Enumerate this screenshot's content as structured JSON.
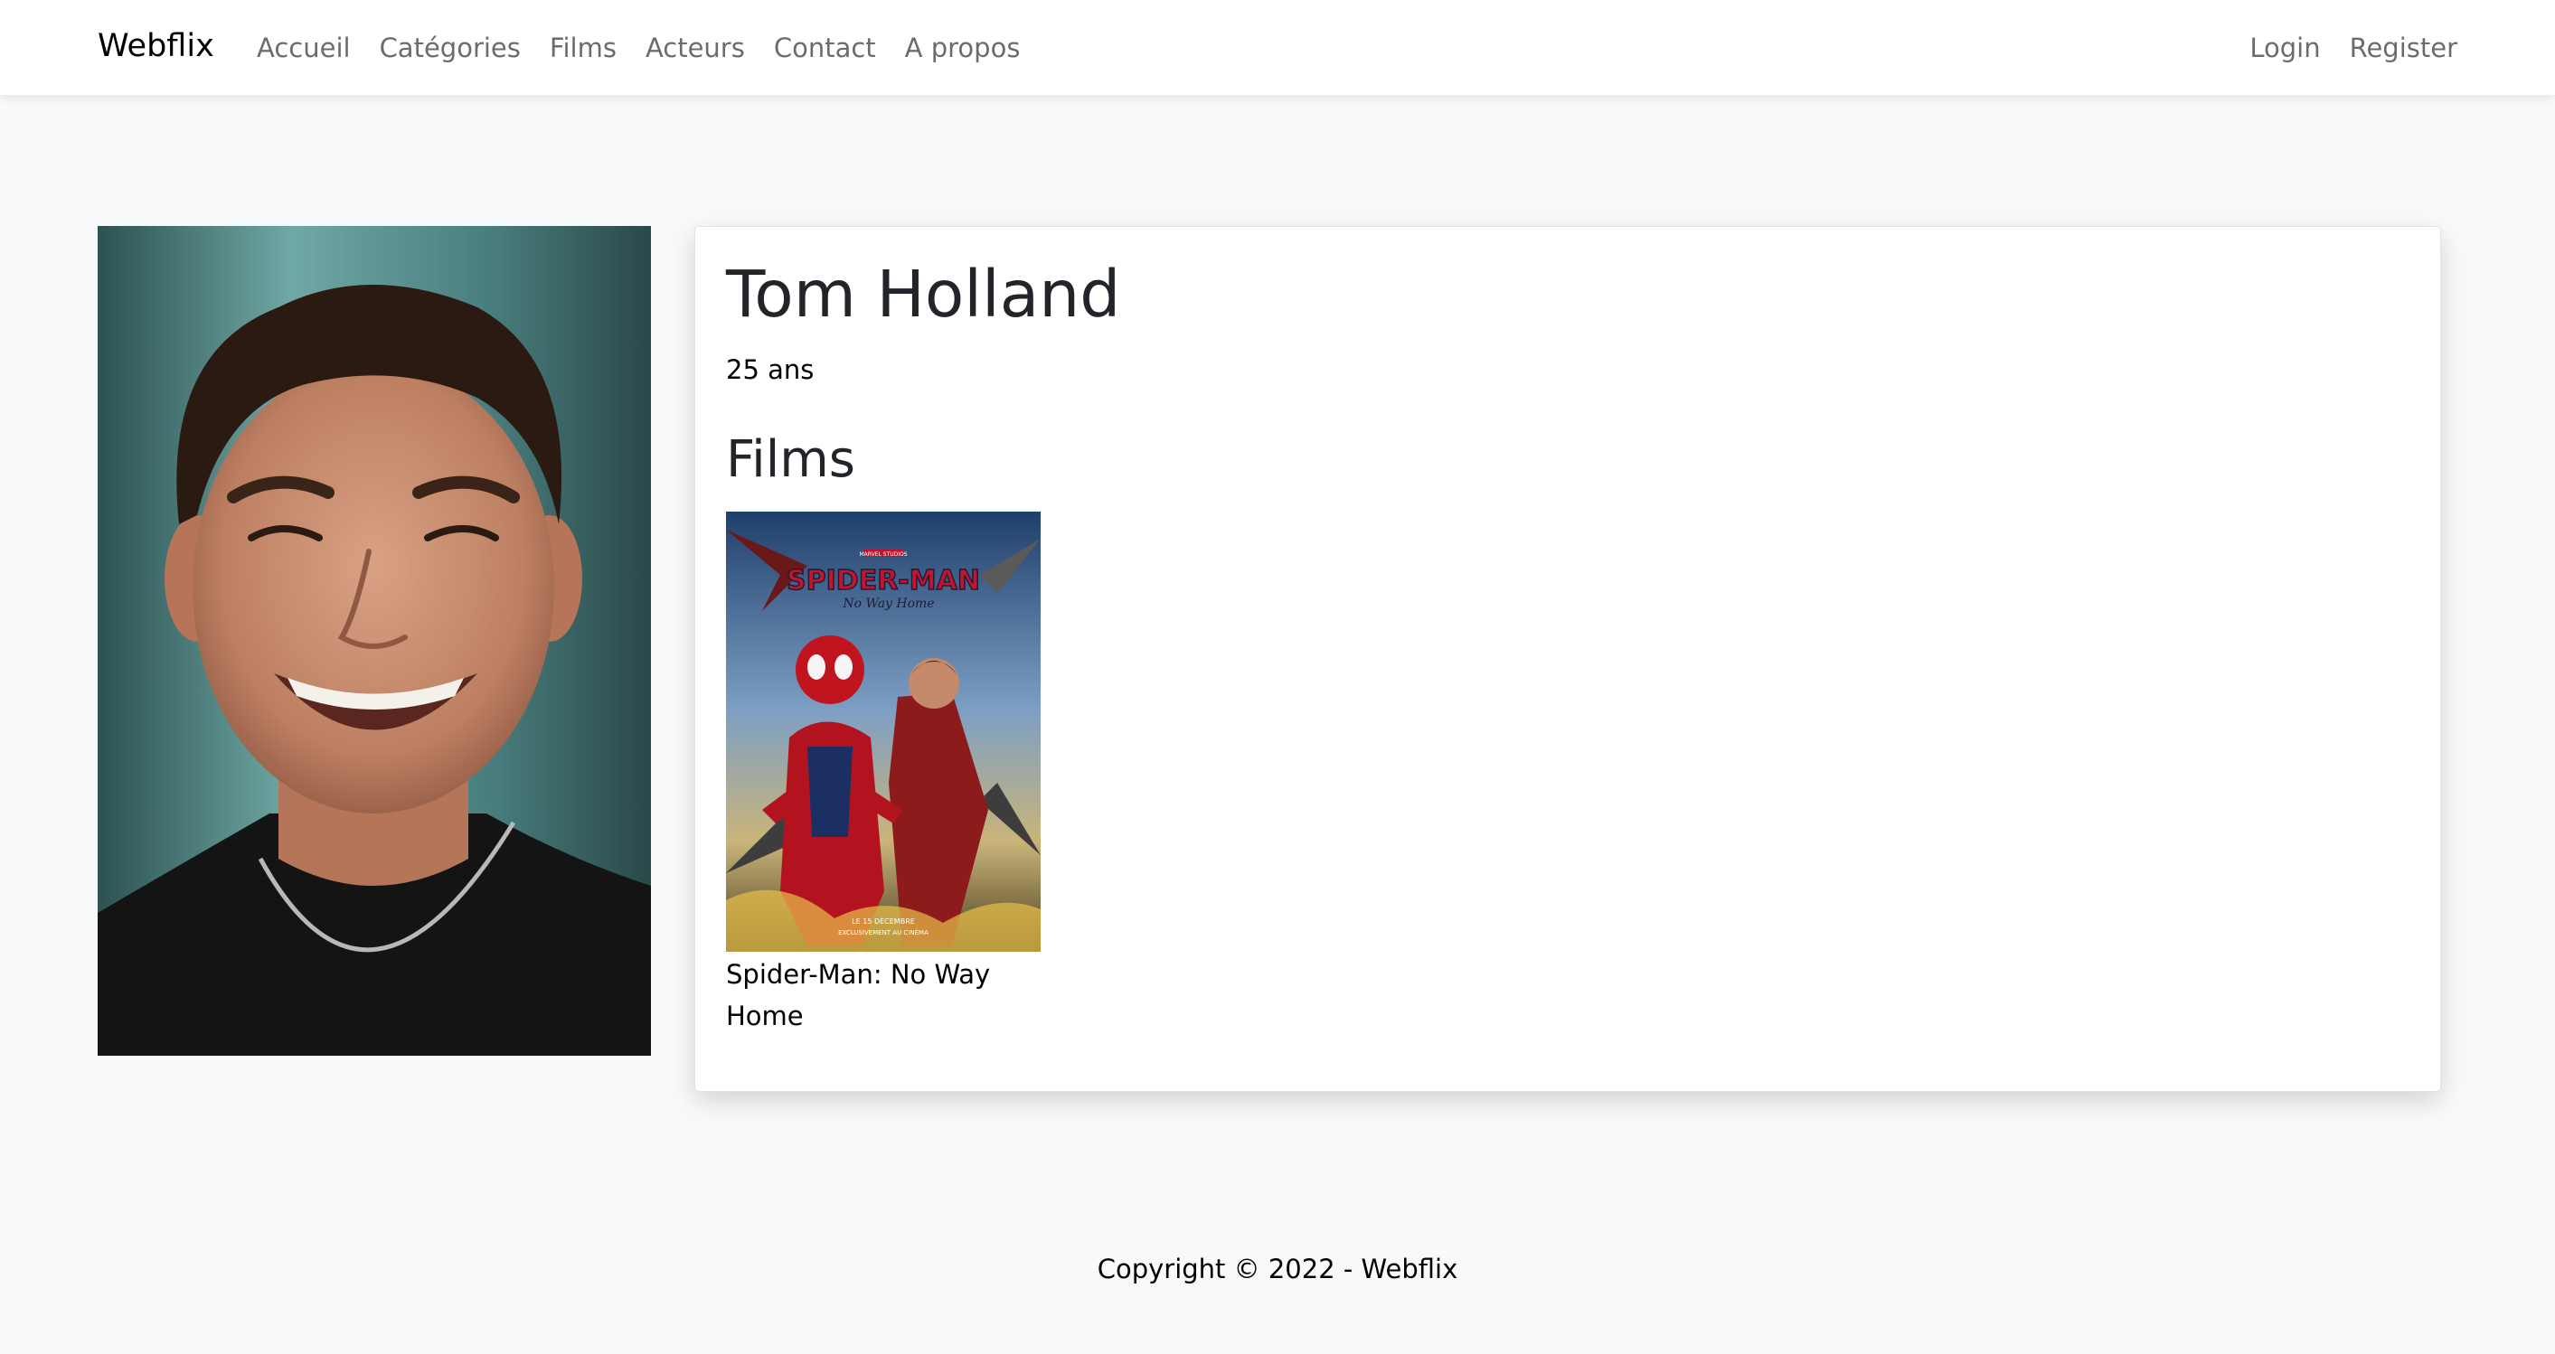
{
  "navbar": {
    "brand": "Webflix",
    "links": [
      "Accueil",
      "Catégories",
      "Films",
      "Acteurs",
      "Contact",
      "A propos"
    ],
    "auth": [
      "Login",
      "Register"
    ]
  },
  "actor": {
    "name": "Tom Holland",
    "age": "25 ans"
  },
  "films": {
    "heading": "Films",
    "items": [
      {
        "title": "Spider-Man: No Way Home",
        "poster_text": {
          "studio": "MARVEL STUDIOS",
          "logo": "SPIDER-MAN",
          "subtitle": "No Way Home",
          "release_date": "LE 15 DÉCEMBRE",
          "release_note": "EXCLUSIVEMENT AU CINÉMA"
        }
      }
    ]
  },
  "footer": {
    "copyright": "Copyright © 2022 - Webflix"
  },
  "colors": {
    "page_background": "#f8f9fa",
    "navbar_background": "#ffffff",
    "nav_link": "#6c6c6c",
    "text": "#212529"
  }
}
